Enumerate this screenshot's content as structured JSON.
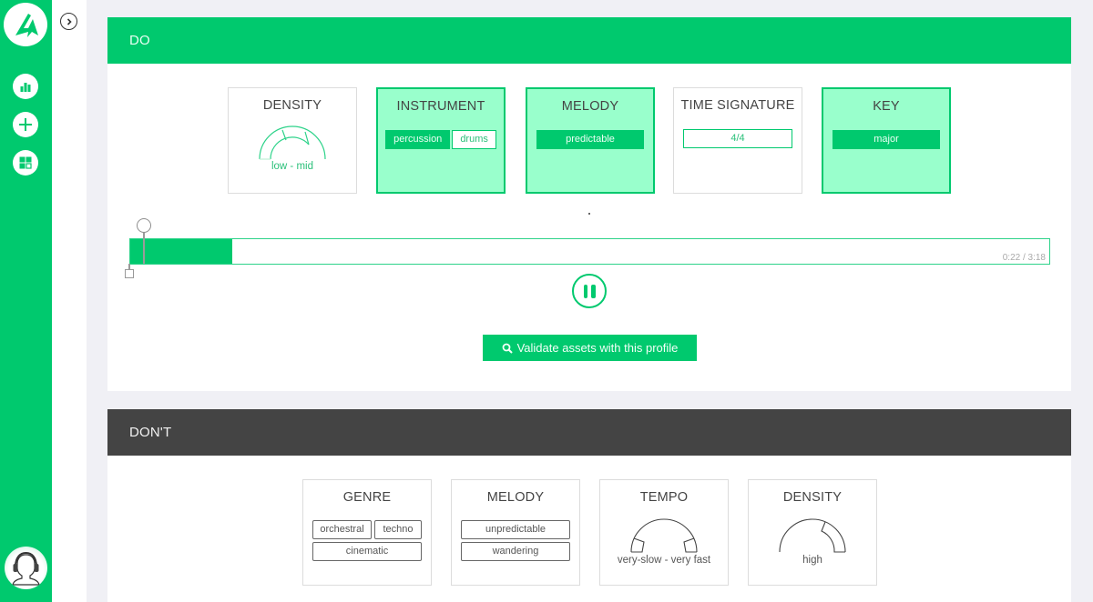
{
  "sidebar": {
    "logo": "app-logo",
    "items": [
      {
        "name": "analytics",
        "icon": "bar-chart-icon"
      },
      {
        "name": "add",
        "icon": "plus-icon"
      },
      {
        "name": "dashboard",
        "icon": "grid-icon"
      }
    ],
    "avatar": "user-headphones-avatar"
  },
  "subnav": {
    "collapse_icon": "chevron-right-icon"
  },
  "colors": {
    "accent": "#00c96e",
    "accent_light": "#99ffcc",
    "dont_header": "#444444",
    "background": "#f0f0f5"
  },
  "do_section": {
    "title": "DO",
    "cards": [
      {
        "title": "DENSITY",
        "active": false,
        "type": "gauge",
        "gauge_range": [
          "low",
          "mid"
        ],
        "label": "low - mid"
      },
      {
        "title": "INSTRUMENT",
        "active": true,
        "type": "chips",
        "chips": [
          {
            "label": "percussion",
            "style": "filled"
          },
          {
            "label": "drums",
            "style": "outline"
          }
        ]
      },
      {
        "title": "MELODY",
        "active": true,
        "type": "chips",
        "chips": [
          {
            "label": "predictable",
            "style": "filled"
          }
        ]
      },
      {
        "title": "TIME SIGNATURE",
        "active": false,
        "type": "chips",
        "chips": [
          {
            "label": "4/4",
            "style": "outline"
          }
        ]
      },
      {
        "title": "KEY",
        "active": true,
        "type": "chips",
        "chips": [
          {
            "label": "major",
            "style": "filled"
          }
        ]
      }
    ],
    "player": {
      "current_time": "0:22",
      "total_time": "3:18",
      "time_display": "0:22 / 3:18",
      "progress_fraction": 0.111,
      "state": "playing",
      "pause_icon": "pause-icon"
    },
    "validate_button": {
      "label": "Validate assets with this profile",
      "icon": "search-icon"
    }
  },
  "dont_section": {
    "title": "DON'T",
    "cards": [
      {
        "title": "GENRE",
        "type": "chips",
        "chips": [
          {
            "label": "orchestral"
          },
          {
            "label": "techno"
          },
          {
            "label": "cinematic"
          }
        ]
      },
      {
        "title": "MELODY",
        "type": "chips",
        "chips": [
          {
            "label": "unpredictable"
          },
          {
            "label": "wandering"
          }
        ]
      },
      {
        "title": "TEMPO",
        "type": "gauge",
        "gauge_range": [
          "very-slow",
          "very fast"
        ],
        "label": "very-slow - very fast"
      },
      {
        "title": "DENSITY",
        "type": "gauge",
        "gauge_range": [
          "high"
        ],
        "label": "high"
      }
    ]
  }
}
